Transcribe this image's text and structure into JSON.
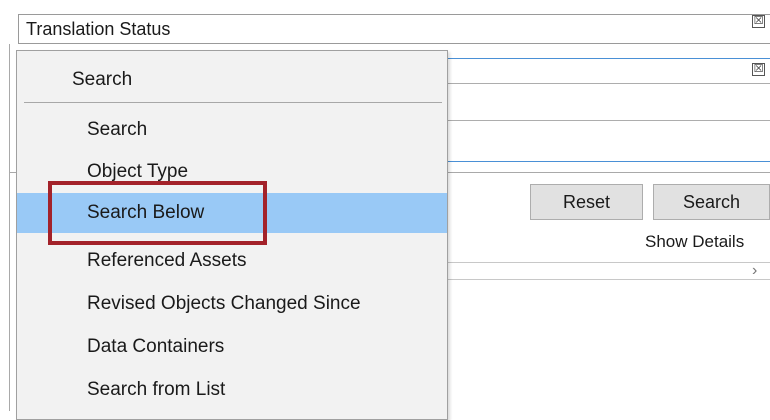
{
  "status_field": {
    "label": "Translation Status"
  },
  "close_glyph": "☒",
  "buttons": {
    "reset": "Reset",
    "search": "Search"
  },
  "show_details": "Show Details",
  "chevron": "›",
  "menu": {
    "header": "Search",
    "items": [
      {
        "label": "Search",
        "selected": false
      },
      {
        "label": "Object Type",
        "selected": false
      },
      {
        "label": "Search Below",
        "selected": true
      },
      {
        "label": "Referenced Assets",
        "selected": false
      },
      {
        "label": "Revised Objects Changed Since",
        "selected": false
      },
      {
        "label": "Data Containers",
        "selected": false
      },
      {
        "label": "Search from List",
        "selected": false
      }
    ]
  },
  "colors": {
    "selection": "#99c9f6",
    "highlight_border": "#a3222a",
    "focus_border": "#4a90d6"
  }
}
